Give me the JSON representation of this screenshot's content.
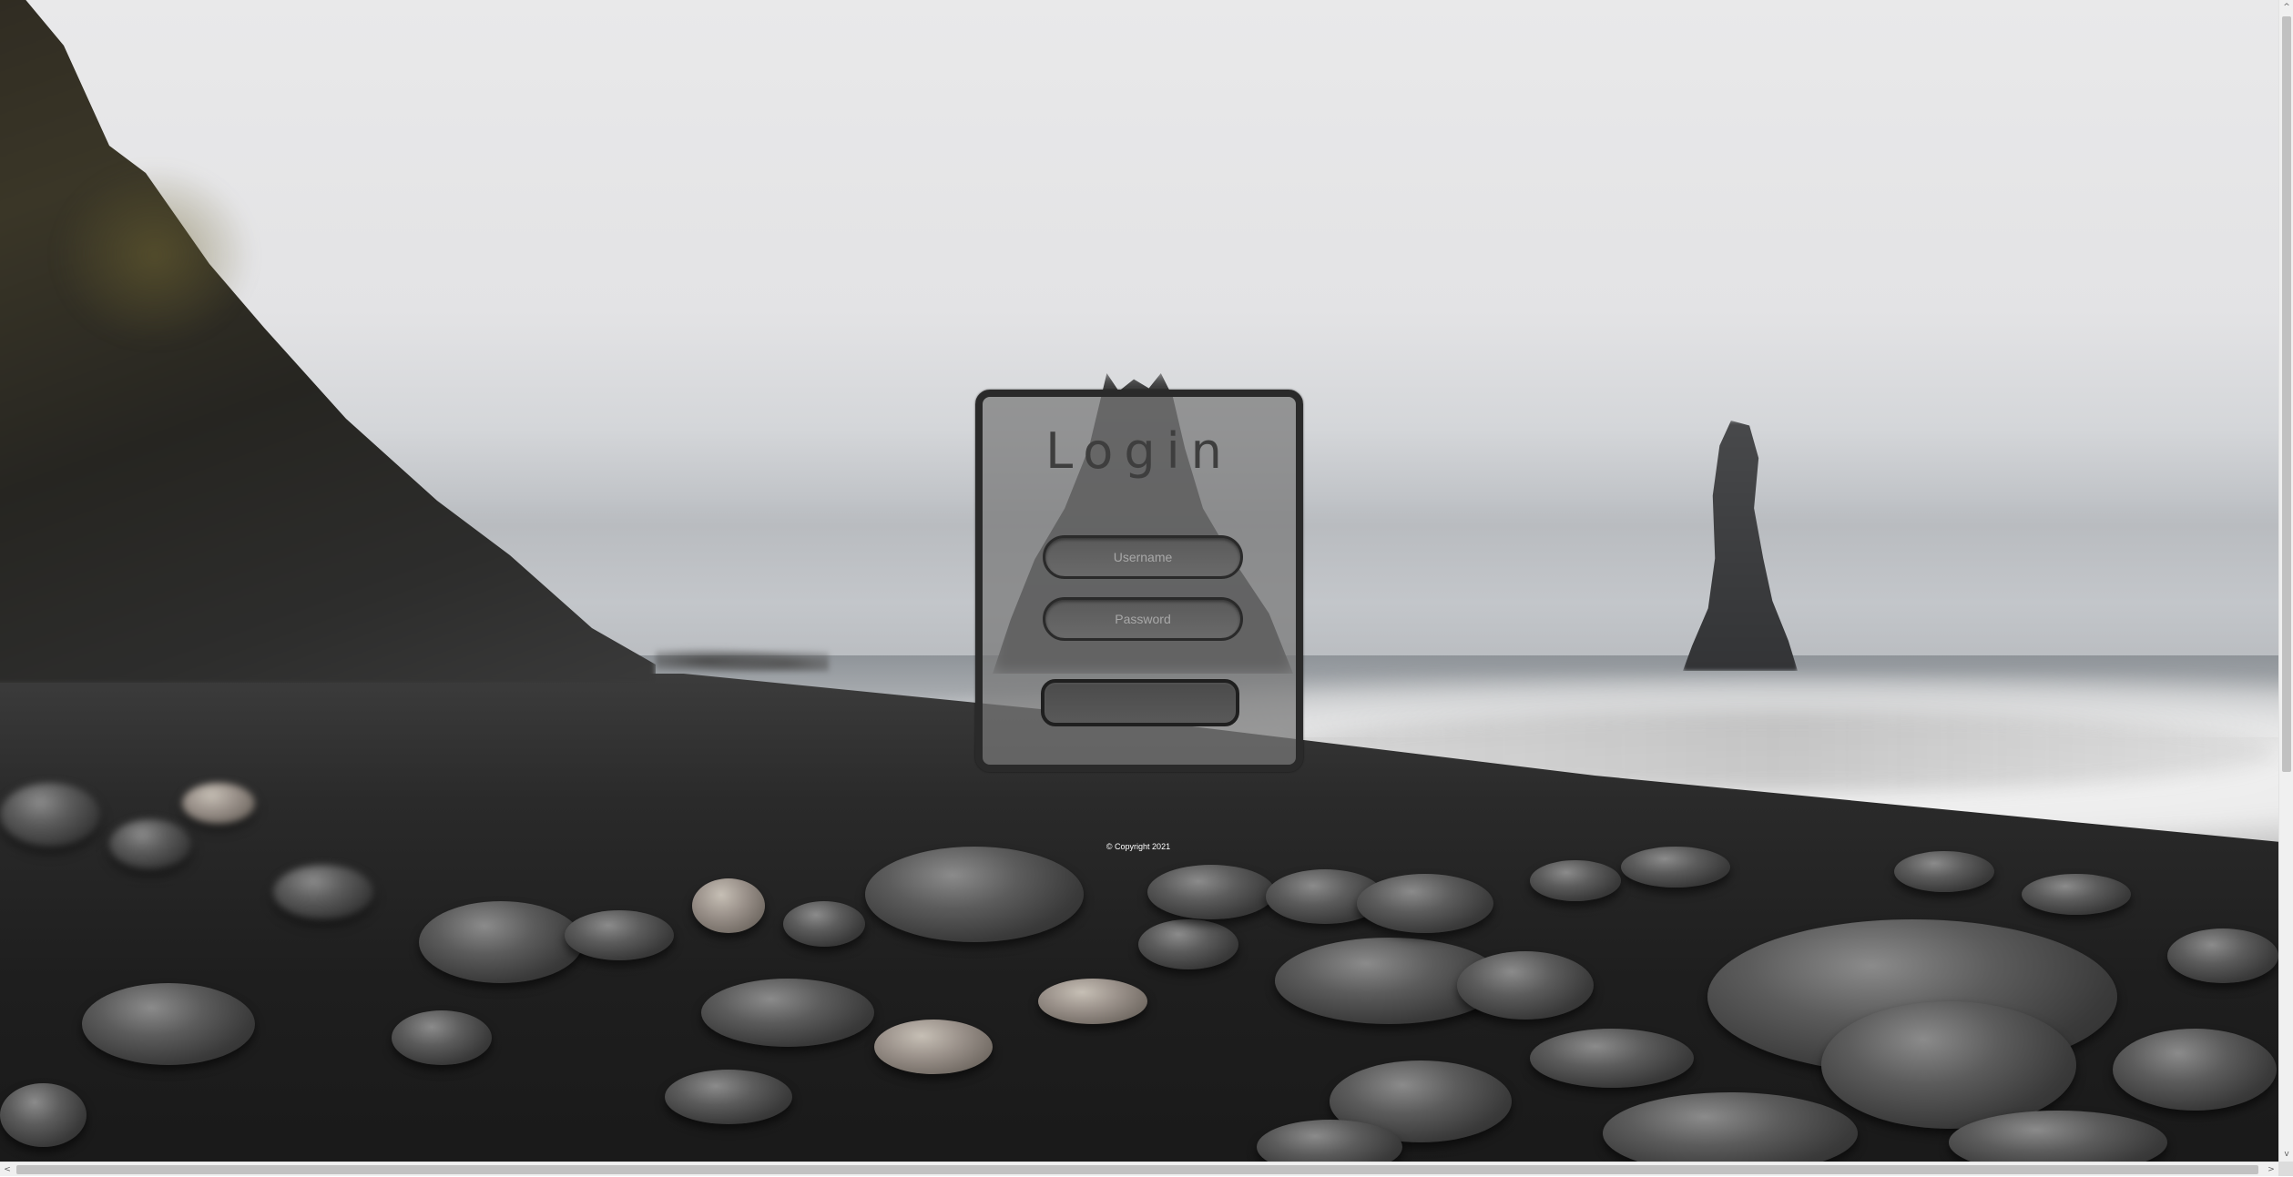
{
  "login": {
    "title": "Login",
    "username_placeholder": "Username",
    "password_placeholder": "Password",
    "submit_label": ""
  },
  "footer": {
    "copyright": "© Copyright 2021"
  },
  "scrollbars": {
    "up_arrow": "^",
    "down_arrow": "v",
    "left_arrow": "<",
    "right_arrow": ">"
  },
  "colors": {
    "card_border": "#2a2a2a",
    "card_fill": "#787878",
    "title_text": "#3e3e3e",
    "footer_text": "#ffffff"
  }
}
